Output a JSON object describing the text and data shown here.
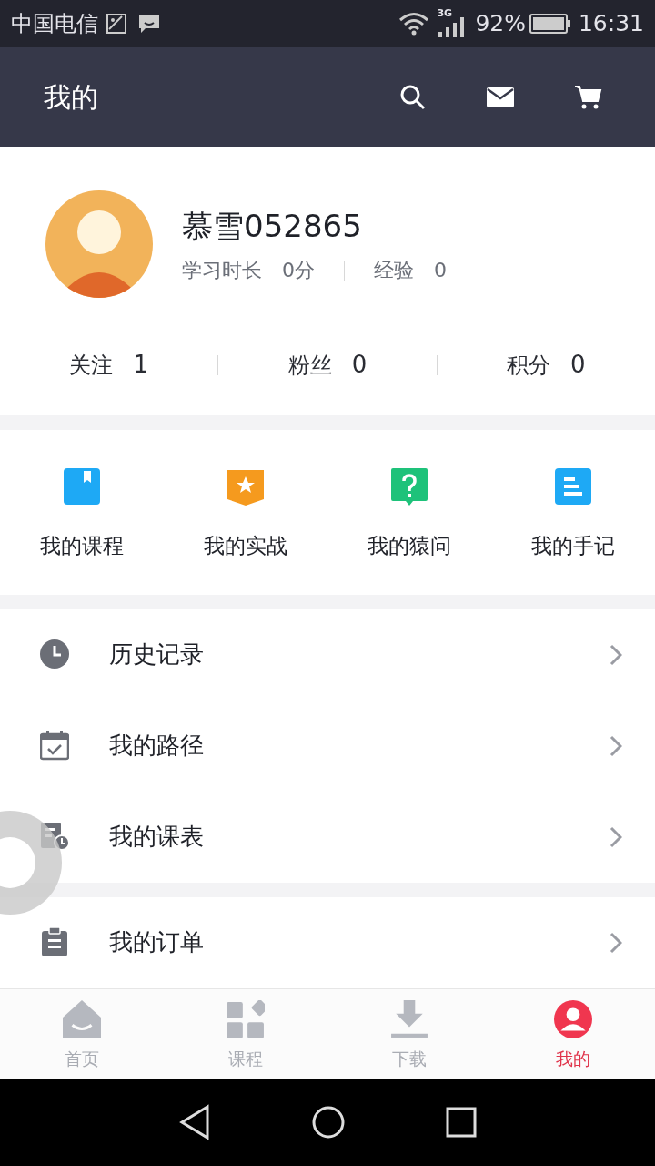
{
  "status_bar": {
    "carrier": "中国电信",
    "network": "3G",
    "battery": "92%",
    "time": "16:31"
  },
  "header": {
    "title": "我的"
  },
  "profile": {
    "name": "慕雪052865",
    "stats": [
      {
        "label": "学习时长",
        "value": "0分"
      },
      {
        "label": "经验",
        "value": "0"
      }
    ],
    "counts": [
      {
        "label": "关注",
        "value": "1"
      },
      {
        "label": "粉丝",
        "value": "0"
      },
      {
        "label": "积分",
        "value": "0"
      }
    ]
  },
  "shortcuts": [
    {
      "label": "我的课程",
      "kind": "bookmark",
      "color": "#1ea9f5"
    },
    {
      "label": "我的实战",
      "kind": "star",
      "color": "#f59a1e"
    },
    {
      "label": "我的猿问",
      "kind": "question",
      "color": "#1ec27a"
    },
    {
      "label": "我的手记",
      "kind": "notes",
      "color": "#1ea9f5"
    }
  ],
  "menu_groups": [
    [
      {
        "label": "历史记录",
        "kind": "clock"
      },
      {
        "label": "我的路径",
        "kind": "calendar"
      },
      {
        "label": "我的课表",
        "kind": "schedule"
      }
    ],
    [
      {
        "label": "我的订单",
        "kind": "clipboard"
      }
    ]
  ],
  "tabs": [
    {
      "label": "首页",
      "kind": "home",
      "selected": false
    },
    {
      "label": "课程",
      "kind": "grid",
      "selected": false
    },
    {
      "label": "下载",
      "kind": "download",
      "selected": false
    },
    {
      "label": "我的",
      "kind": "user",
      "selected": true
    }
  ]
}
